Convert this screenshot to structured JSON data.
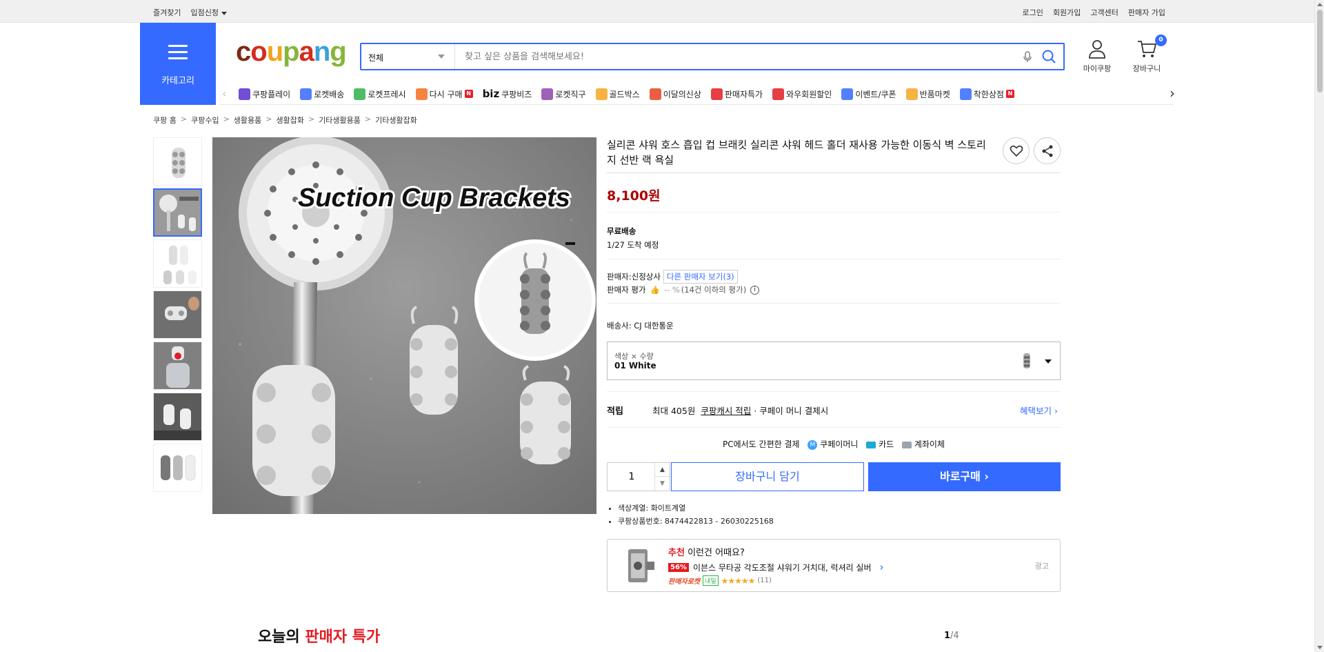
{
  "topbar": {
    "left": [
      "즐겨찾기",
      "입점신청"
    ],
    "right": [
      "로그인",
      "회원가입",
      "고객센터",
      "판매자 가입"
    ]
  },
  "category_button": {
    "label": "카테고리"
  },
  "logo": {
    "letters": [
      "c",
      "o",
      "u",
      "p",
      "a",
      "n",
      "g"
    ],
    "colors": [
      "#7b2b14",
      "#d52b1e",
      "#f2a41b",
      "#87b53a",
      "#d52b1e",
      "#3aa1da",
      "#87b53a"
    ]
  },
  "search": {
    "category": "전체",
    "placeholder": "찾고 싶은 상품을 검색해보세요!"
  },
  "header_icons": {
    "my": "마이쿠팡",
    "cart": "장바구니",
    "cart_count": "0"
  },
  "nav": {
    "items": [
      {
        "label": "쿠팡플레이",
        "icon": "play-icon",
        "color": "#5a2dd1"
      },
      {
        "label": "로켓배송",
        "icon": "rocket-icon",
        "color": "#346aff"
      },
      {
        "label": "로켓프레시",
        "icon": "rocket-fresh-icon",
        "color": "#2eb34a"
      },
      {
        "label": "다시 구매",
        "icon": "rebuy-icon",
        "color": "#f36d21",
        "new": "N"
      },
      {
        "label": "쿠팡비즈",
        "icon": "biz-icon",
        "color": "#111111",
        "prefix": "biz"
      },
      {
        "label": "로켓직구",
        "icon": "global-icon",
        "color": "#8e44ad"
      },
      {
        "label": "골드박스",
        "icon": "goldbox-icon",
        "color": "#f5a623"
      },
      {
        "label": "이달의신상",
        "icon": "new-icon",
        "color": "#e8431f"
      },
      {
        "label": "판매자특가",
        "icon": "percent-icon",
        "color": "#e31b23"
      },
      {
        "label": "와우회원할인",
        "icon": "wow-icon",
        "color": "#e31b23"
      },
      {
        "label": "이벤트/쿠폰",
        "icon": "coupon-icon",
        "color": "#346aff"
      },
      {
        "label": "반품마켓",
        "icon": "market-icon",
        "color": "#f5a623"
      },
      {
        "label": "착한상점",
        "icon": "shop-icon",
        "color": "#346aff",
        "new": "N"
      }
    ]
  },
  "breadcrumb": [
    "쿠팡 홈",
    "쿠팡수입",
    "생활용품",
    "생활잡화",
    "기타생활용품",
    "기타생활잡화"
  ],
  "main_image": {
    "overlay_text": "Suction Cup Brackets"
  },
  "product": {
    "title": "실리콘 샤워 호스 흡입 컵 브래킷 실리콘 샤워 헤드 홀더 재사용 가능한 이동식 벽 스토리지 선반 랙 욕실",
    "price": "8,100원",
    "shipping_label": "무료배송",
    "arrival": "1/27 도착 예정",
    "seller_label": "판매자:",
    "seller": "신정상사",
    "other_sellers": "다른 판매자 보기",
    "other_sellers_count": "(3)",
    "rating_label": "판매자 평가",
    "rating_value": "-- %",
    "rating_note": "(14건 이하의 평가)",
    "carrier_label": "배송사:",
    "carrier": "CJ 대한통운",
    "option_label": "색상 × 수량",
    "option_value": "01 White",
    "reward_label": "적립",
    "reward_max": "최대 405원",
    "reward_link": "쿠팡캐시 적립",
    "reward_tail": "· 쿠페이 머니 결제시",
    "benefit_link": "혜택보기",
    "pay_intro": "PC에서도 간편한 결제",
    "pay_methods": [
      "쿠페이머니",
      "카드",
      "계좌이체"
    ],
    "quantity": "1",
    "add_cart": "장바구니 담기",
    "buy_now": "바로구매",
    "bullets": [
      "색상계열: 화이트계열",
      "쿠팡상품번호: 8474422813 - 26030225168"
    ]
  },
  "recommend": {
    "heading_red": "추천",
    "heading": "이런건 어때요?",
    "discount": "56%",
    "name": "이븐스 무타공 각도조절 샤워기 거치대, 럭셔리 실버",
    "badge": "판매자로켓",
    "tomorrow": "내일",
    "reviews": "(11)",
    "ad": "광고"
  },
  "deal": {
    "prefix": "오늘의 ",
    "highlight": "판매자 특가",
    "page_current": "1",
    "page_total": "/4"
  }
}
